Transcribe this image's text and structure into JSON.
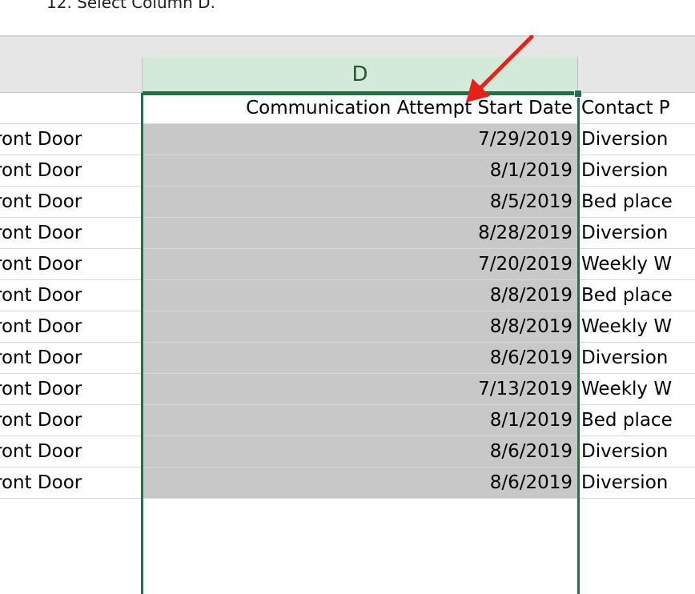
{
  "instruction": "12. Select Column D.",
  "columns": {
    "d_header": "D"
  },
  "colors": {
    "selection_border": "#217346",
    "selected_header_bg": "#d3ead9",
    "selected_cell_bg": "#c8c8c8",
    "arrow": "#e8201a"
  },
  "table": {
    "header": {
      "c": "",
      "d": "Communication Attempt Start Date",
      "e": "Contact P"
    },
    "rows": [
      {
        "c": "ront Door",
        "d": "7/29/2019",
        "e": "Diversion"
      },
      {
        "c": "ront Door",
        "d": "8/1/2019",
        "e": "Diversion"
      },
      {
        "c": "ront Door",
        "d": "8/5/2019",
        "e": "Bed place"
      },
      {
        "c": "ront Door",
        "d": "8/28/2019",
        "e": "Diversion"
      },
      {
        "c": "ront Door",
        "d": "7/20/2019",
        "e": "Weekly W"
      },
      {
        "c": "ront Door",
        "d": "8/8/2019",
        "e": "Bed place"
      },
      {
        "c": "ront Door",
        "d": "8/8/2019",
        "e": "Weekly W"
      },
      {
        "c": "ront Door",
        "d": "8/6/2019",
        "e": "Diversion"
      },
      {
        "c": "ront Door",
        "d": "7/13/2019",
        "e": "Weekly W"
      },
      {
        "c": "ront Door",
        "d": "8/1/2019",
        "e": "Bed place"
      },
      {
        "c": "ront Door",
        "d": "8/6/2019",
        "e": "Diversion"
      },
      {
        "c": "ront Door",
        "d": "8/6/2019",
        "e": "Diversion"
      }
    ]
  },
  "icons": {
    "annotation": "red-arrow-icon"
  }
}
